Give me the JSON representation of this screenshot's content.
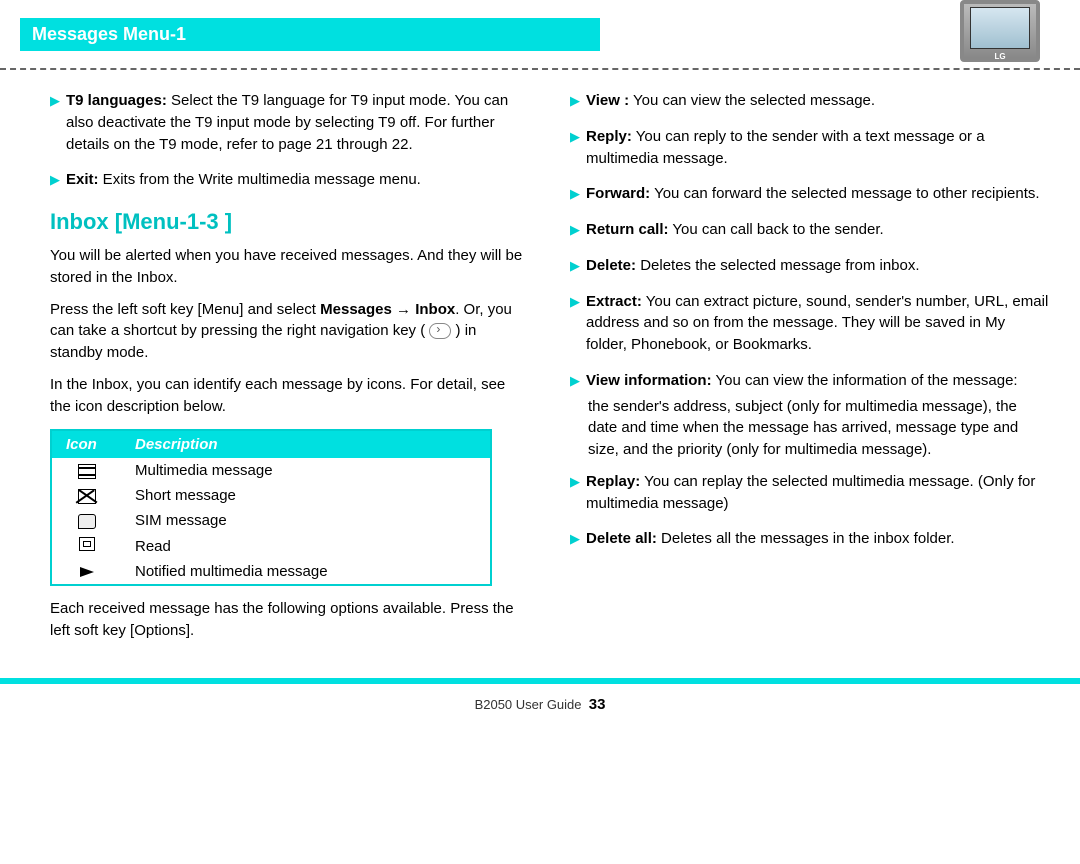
{
  "header": {
    "title": "Messages Menu-1"
  },
  "phone_brand": "LG",
  "left": {
    "items": [
      {
        "bold": "T9 languages:",
        "text": " Select the T9 language for T9 input mode. You can also deactivate the T9 input mode by selecting T9 off. For further details on the T9 mode, refer to page 21 through 22."
      },
      {
        "bold": "Exit:",
        "text": " Exits from the Write multimedia message menu."
      }
    ],
    "section_title": "Inbox [Menu-1-3 ]",
    "para1": "You will be alerted when you have received messages. And they will be stored in the Inbox.",
    "para2_pre": "Press the left soft key [Menu] and select ",
    "para2_bold1": "Messages",
    "para2_arrow": " → ",
    "para2_bold2": "Inbox",
    "para2_post": ". Or, you can take a shortcut by pressing the right navigation key ( ",
    "para2_post2": " ) in standby mode.",
    "para3": "In the Inbox, you can identify each message by icons. For detail, see the icon description below.",
    "table": {
      "headers": [
        "Icon",
        "Description"
      ],
      "rows": [
        {
          "icon": "mms",
          "desc": "Multimedia message"
        },
        {
          "icon": "sms",
          "desc": "Short message"
        },
        {
          "icon": "sim",
          "desc": "SIM message"
        },
        {
          "icon": "read",
          "desc": "Read"
        },
        {
          "icon": "flag",
          "desc": "Notified multimedia message"
        }
      ]
    },
    "para4": "Each received message has the following options available. Press the left soft key [Options]."
  },
  "right": {
    "items": [
      {
        "bold": "View :",
        "text": " You can view the selected message."
      },
      {
        "bold": "Reply:",
        "text": " You can reply to the sender with a text message or a multimedia message."
      },
      {
        "bold": "Forward:",
        "text": " You can forward the selected message to other recipients."
      },
      {
        "bold": "Return call:",
        "text": " You can call back to the sender."
      },
      {
        "bold": "Delete:",
        "text": " Deletes the selected message from inbox."
      },
      {
        "bold": "Extract:",
        "text": " You can extract picture, sound, sender's number, URL, email address and so on from the message. They will be saved in My folder, Phonebook, or Bookmarks."
      },
      {
        "bold": "View information:",
        "text": " You can view the information of the message:",
        "tail": "the sender's address, subject (only for multimedia message), the date and time when the message has arrived, message type and size, and the priority (only for multimedia message)."
      },
      {
        "bold": "Replay:",
        "text": " You can replay the selected multimedia message. (Only for multimedia message)"
      },
      {
        "bold": "Delete all:",
        "text": " Deletes all the messages in the inbox folder."
      }
    ]
  },
  "footer": {
    "guide": "B2050 User Guide",
    "page": "33"
  }
}
